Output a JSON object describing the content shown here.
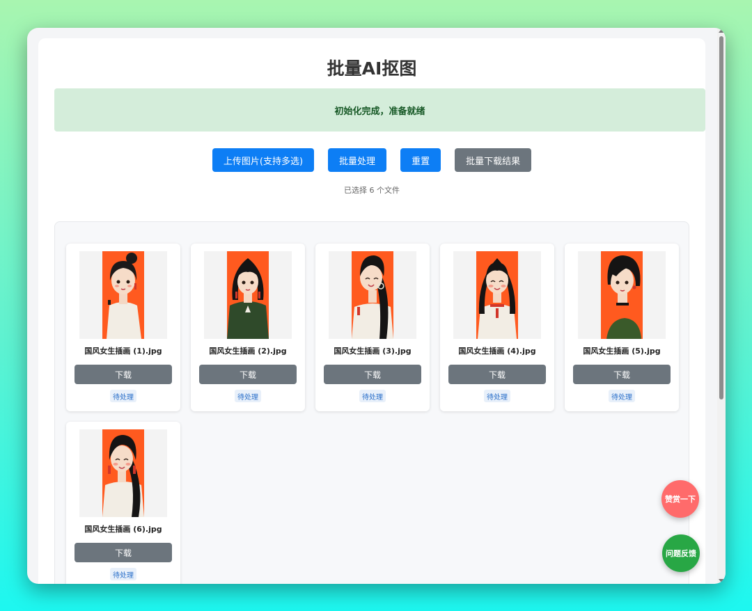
{
  "app": {
    "title": "批量AI抠图",
    "status_message": "初始化完成，准备就绪",
    "file_count_text": "已选择 6 个文件"
  },
  "toolbar": {
    "upload_label": "上传图片(支持多选)",
    "batch_process_label": "批量处理",
    "reset_label": "重置",
    "batch_download_label": "批量下载结果"
  },
  "gallery": {
    "items": [
      {
        "filename": "国风女生插画 (1).jpg",
        "download_label": "下载",
        "status": "待处理"
      },
      {
        "filename": "国风女生插画 (2).jpg",
        "download_label": "下载",
        "status": "待处理"
      },
      {
        "filename": "国风女生插画 (3).jpg",
        "download_label": "下载",
        "status": "待处理"
      },
      {
        "filename": "国风女生插画 (4).jpg",
        "download_label": "下载",
        "status": "待处理"
      },
      {
        "filename": "国风女生插画 (5).jpg",
        "download_label": "下载",
        "status": "待处理"
      },
      {
        "filename": "国风女生插画 (6).jpg",
        "download_label": "下载",
        "status": "待处理"
      }
    ]
  },
  "floating": {
    "reward_label": "赞赏一下",
    "feedback_label": "问题反馈"
  },
  "colors": {
    "primary": "#0d7ef5",
    "secondary": "#6c757d",
    "success_bg": "#d4edda",
    "success_text": "#155724",
    "reward": "#ff6b6b",
    "feedback": "#28a745",
    "illustration_orange": "#ff5a1f"
  }
}
